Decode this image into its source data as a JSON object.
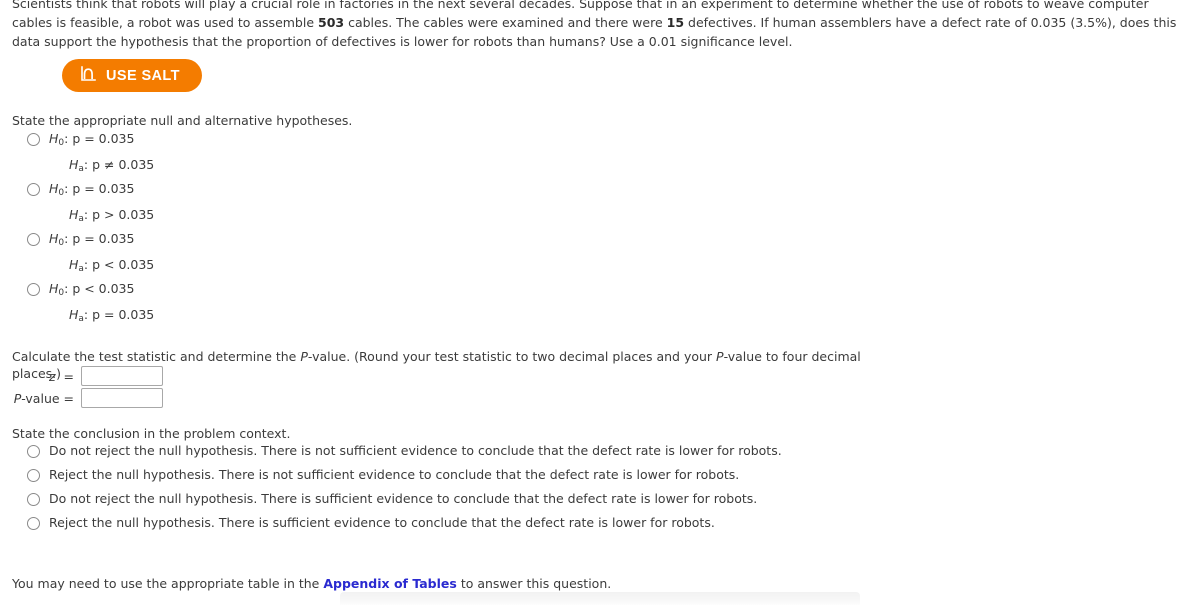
{
  "problem": {
    "text_before_n": "Scientists think that robots will play a crucial role in factories in the next several decades. Suppose that in an experiment to determine whether the use of robots to weave computer cables is feasible, a robot was used to assemble ",
    "n_cables": "503",
    "text_mid": " cables. The cables were examined and there were ",
    "defectives": "15",
    "text_after": " defectives. If human assemblers have a defect rate of 0.035 (3.5%), does this data support the hypothesis that the proportion of defectives is lower for robots than humans? Use a 0.01 significance level."
  },
  "salt_button": {
    "label": "USE SALT",
    "icon": "distribution-curve-icon",
    "background_color": "#f47c00",
    "text_color": "#ffffff"
  },
  "hypotheses_section": {
    "prompt": "State the appropriate null and alternative hypotheses.",
    "options": [
      {
        "null": "H₀: p = 0.035",
        "alt": "Hₐ: p ≠ 0.035",
        "null_sub": "0",
        "null_rest": ": p = 0.035",
        "alt_sub": "a",
        "alt_rest": ": p ≠ 0.035",
        "selected": false
      },
      {
        "null": "H₀: p = 0.035",
        "alt": "Hₐ: p > 0.035",
        "null_sub": "0",
        "null_rest": ": p = 0.035",
        "alt_sub": "a",
        "alt_rest": ": p > 0.035",
        "selected": false
      },
      {
        "null": "H₀: p = 0.035",
        "alt": "Hₐ: p < 0.035",
        "null_sub": "0",
        "null_rest": ": p = 0.035",
        "alt_sub": "a",
        "alt_rest": ": p < 0.035",
        "selected": false
      },
      {
        "null": "H₀: p < 0.035",
        "alt": "Hₐ: p = 0.035",
        "null_sub": "0",
        "null_rest": ": p < 0.035",
        "alt_sub": "a",
        "alt_rest": ": p = 0.035",
        "selected": false
      }
    ]
  },
  "test_statistic_section": {
    "prompt_part1": "Calculate the test statistic and determine the ",
    "prompt_pvalue1": "P",
    "prompt_part2": "-value. (Round your test statistic to two decimal places and your ",
    "prompt_pvalue2": "P",
    "prompt_part3": "-value to four decimal places.)",
    "z_label": "z  =",
    "z_value": "",
    "z_placeholder": "",
    "pvalue_label_italic": "P",
    "pvalue_label_rest": "-value  =",
    "pvalue_value": "",
    "pvalue_placeholder": ""
  },
  "conclusion_section": {
    "prompt": "State the conclusion in the problem context.",
    "options": [
      {
        "text": "Do not reject the null hypothesis. There is not sufficient evidence to conclude that the defect rate is lower for robots.",
        "selected": false
      },
      {
        "text": "Reject the null hypothesis. There is not sufficient evidence to conclude that the defect rate is lower for robots.",
        "selected": false
      },
      {
        "text": "Do not reject the null hypothesis. There is sufficient evidence to conclude that the defect rate is lower for robots.",
        "selected": false
      },
      {
        "text": "Reject the null hypothesis. There is sufficient evidence to conclude that the defect rate is lower for robots.",
        "selected": false
      }
    ]
  },
  "appendix_note": {
    "before": "You may need to use the appropriate table in the ",
    "link": "Appendix of Tables",
    "after": " to answer this question.",
    "link_color": "#2a2ad0"
  }
}
